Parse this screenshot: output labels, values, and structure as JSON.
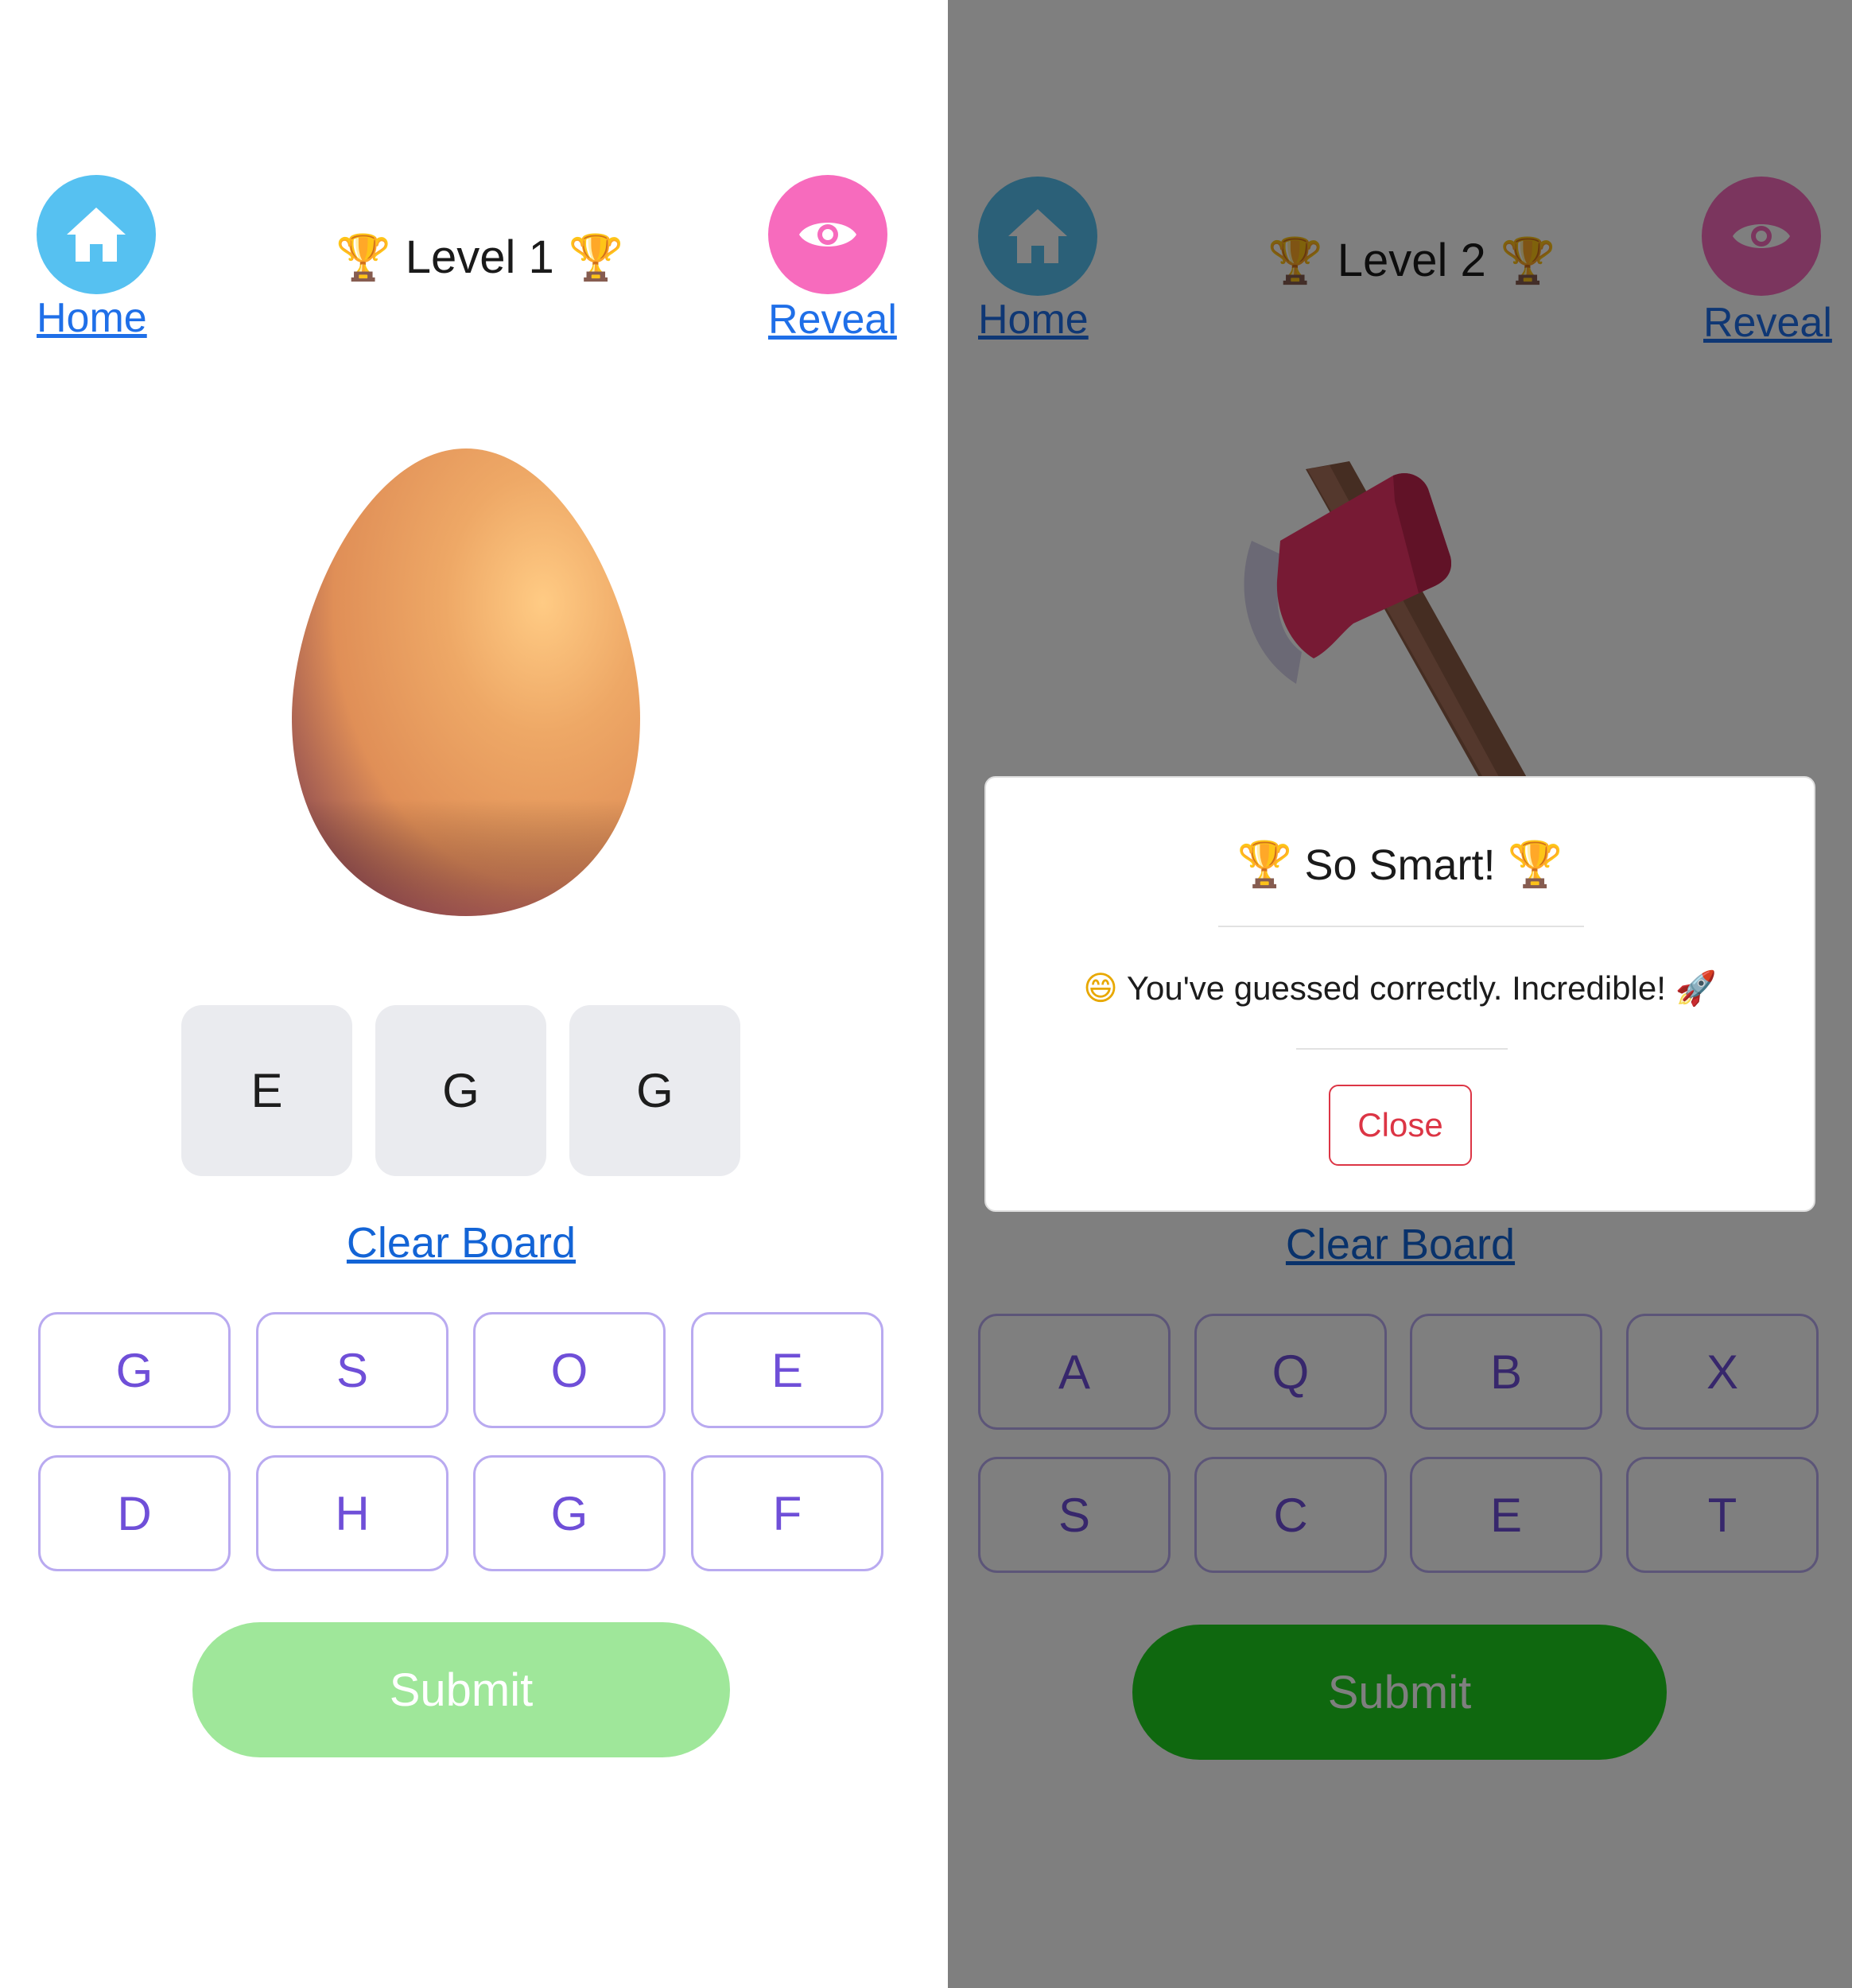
{
  "left_screen": {
    "nav": {
      "home_label": "Home",
      "reveal_label": "Reveal",
      "level_title": "Level 1"
    },
    "answer_tiles": [
      "E",
      "G",
      "G"
    ],
    "clear_label": "Clear Board",
    "letters": [
      "G",
      "S",
      "O",
      "E",
      "D",
      "H",
      "G",
      "F"
    ],
    "submit_label": "Submit",
    "image_icon": "egg-3d-icon"
  },
  "right_screen": {
    "nav": {
      "home_label": "Home",
      "reveal_label": "Reveal",
      "level_title": "Level 2"
    },
    "clear_label": "Clear Board",
    "letters": [
      "A",
      "Q",
      "B",
      "X",
      "S",
      "C",
      "E",
      "T"
    ],
    "submit_label": "Submit",
    "image_icon": "axe-3d-icon",
    "modal": {
      "title": "So Smart!",
      "message": "You've guessed correctly. Incredible!",
      "close_label": "Close"
    }
  },
  "icons": {
    "home": "home-icon",
    "reveal": "eye-icon",
    "title_decoration": "trophy-icon",
    "message_start": "grinning-face-icon",
    "message_end": "rocket-icon"
  },
  "colors": {
    "home_circle": "#56c1f1",
    "reveal_circle": "#f76bbd",
    "letter_text": "#6f4fd8",
    "submit_disabled": "#9fe79a",
    "submit_enabled": "#1fd11f",
    "close_button": "#dc3545",
    "overlay": "rgba(0,0,0,0.5)"
  }
}
